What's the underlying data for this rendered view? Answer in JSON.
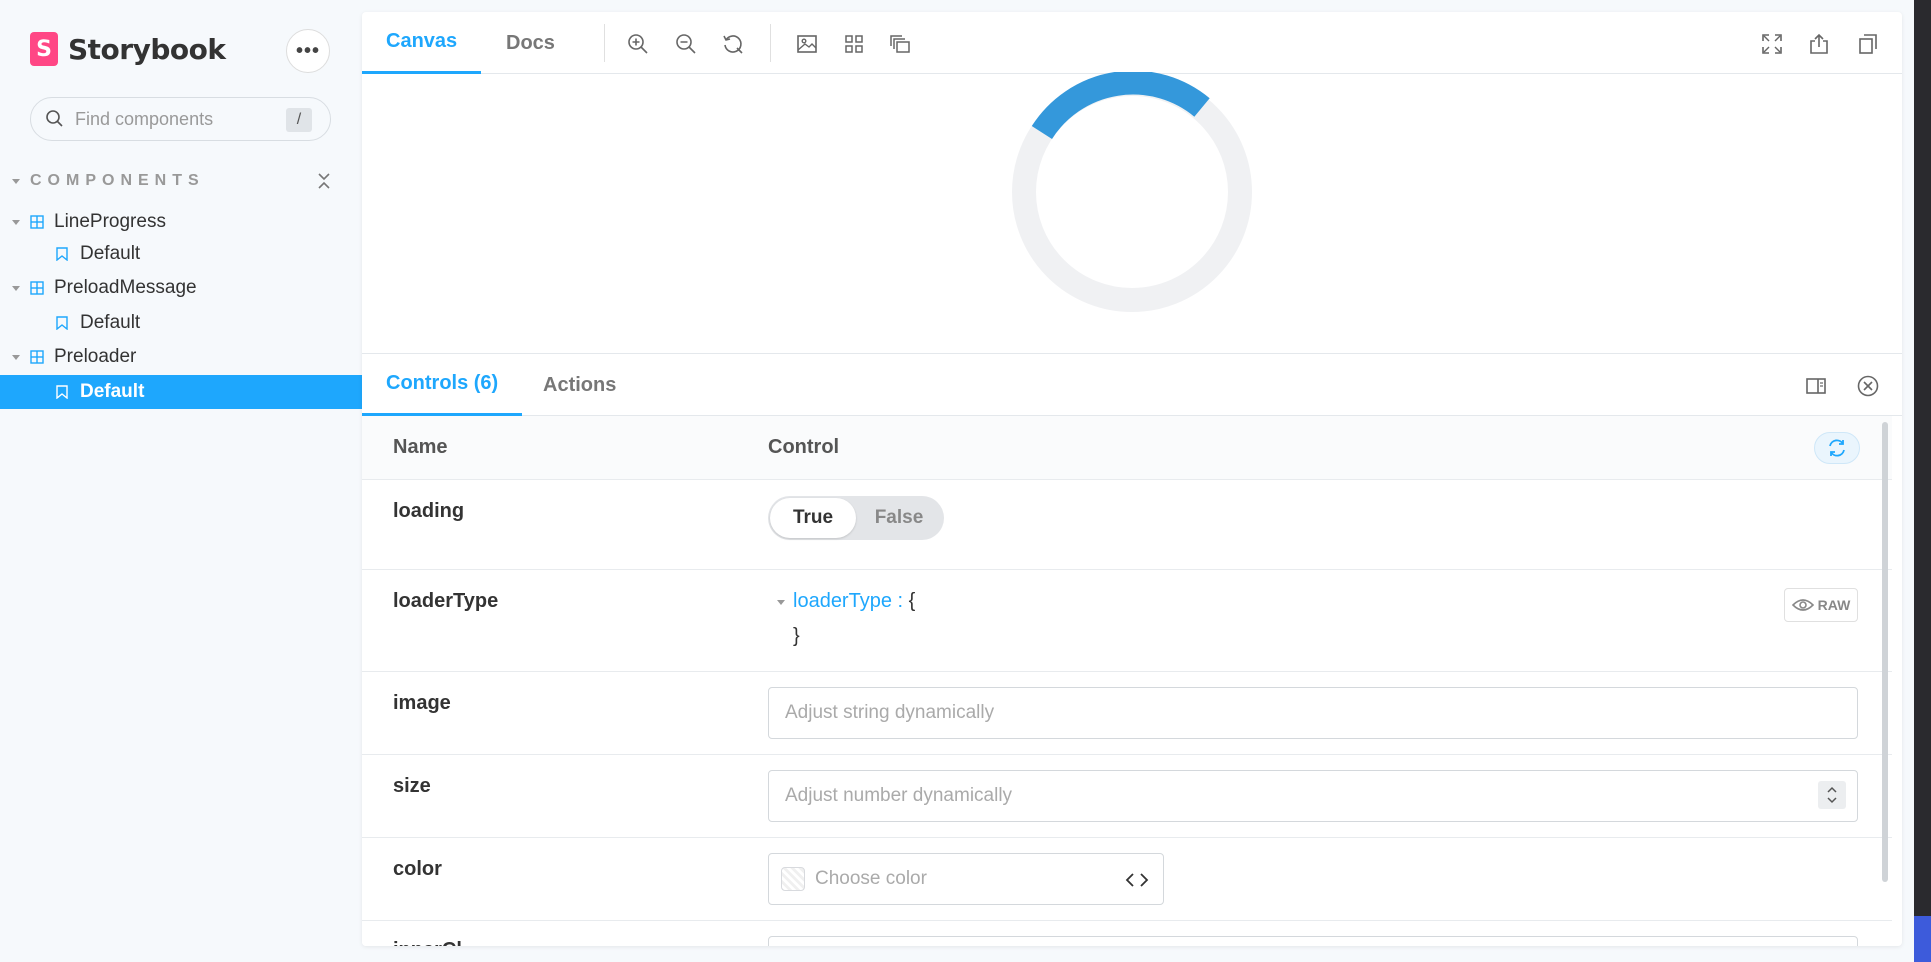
{
  "sidebar": {
    "brand": "Storybook",
    "logo_letter": "S",
    "menu_label": "•••",
    "search": {
      "placeholder": "Find components",
      "shortcut": "/"
    },
    "section_title": "COMPONENTS",
    "tree": [
      {
        "type": "component",
        "label": "LineProgress"
      },
      {
        "type": "story",
        "label": "Default"
      },
      {
        "type": "component",
        "label": "PreloadMessage"
      },
      {
        "type": "story",
        "label": "Default"
      },
      {
        "type": "component",
        "label": "Preloader"
      },
      {
        "type": "story",
        "label": "Default",
        "selected": true
      }
    ]
  },
  "toolbar": {
    "tabs": [
      "Canvas",
      "Docs"
    ],
    "active_tab": "Canvas"
  },
  "preview": {
    "spinner_color": "#3498db",
    "track_color": "#f0f1f3"
  },
  "addons": {
    "tabs": [
      "Controls (6)",
      "Actions"
    ],
    "active_tab": "Controls (6)"
  },
  "controls": {
    "header": {
      "name": "Name",
      "control": "Control"
    },
    "loading": {
      "name": "loading",
      "true_label": "True",
      "false_label": "False",
      "value": true
    },
    "loaderType": {
      "name": "loaderType",
      "key": "loaderType :",
      "open": "{",
      "close": "}",
      "raw_label": "RAW"
    },
    "image": {
      "name": "image",
      "placeholder": "Adjust string dynamically"
    },
    "size": {
      "name": "size",
      "placeholder": "Adjust number dynamically"
    },
    "color": {
      "name": "color",
      "placeholder": "Choose color"
    },
    "next": {
      "name": "innerCl"
    }
  },
  "colors": {
    "accent": "#1ea7fd",
    "brand": "#ff4785"
  }
}
